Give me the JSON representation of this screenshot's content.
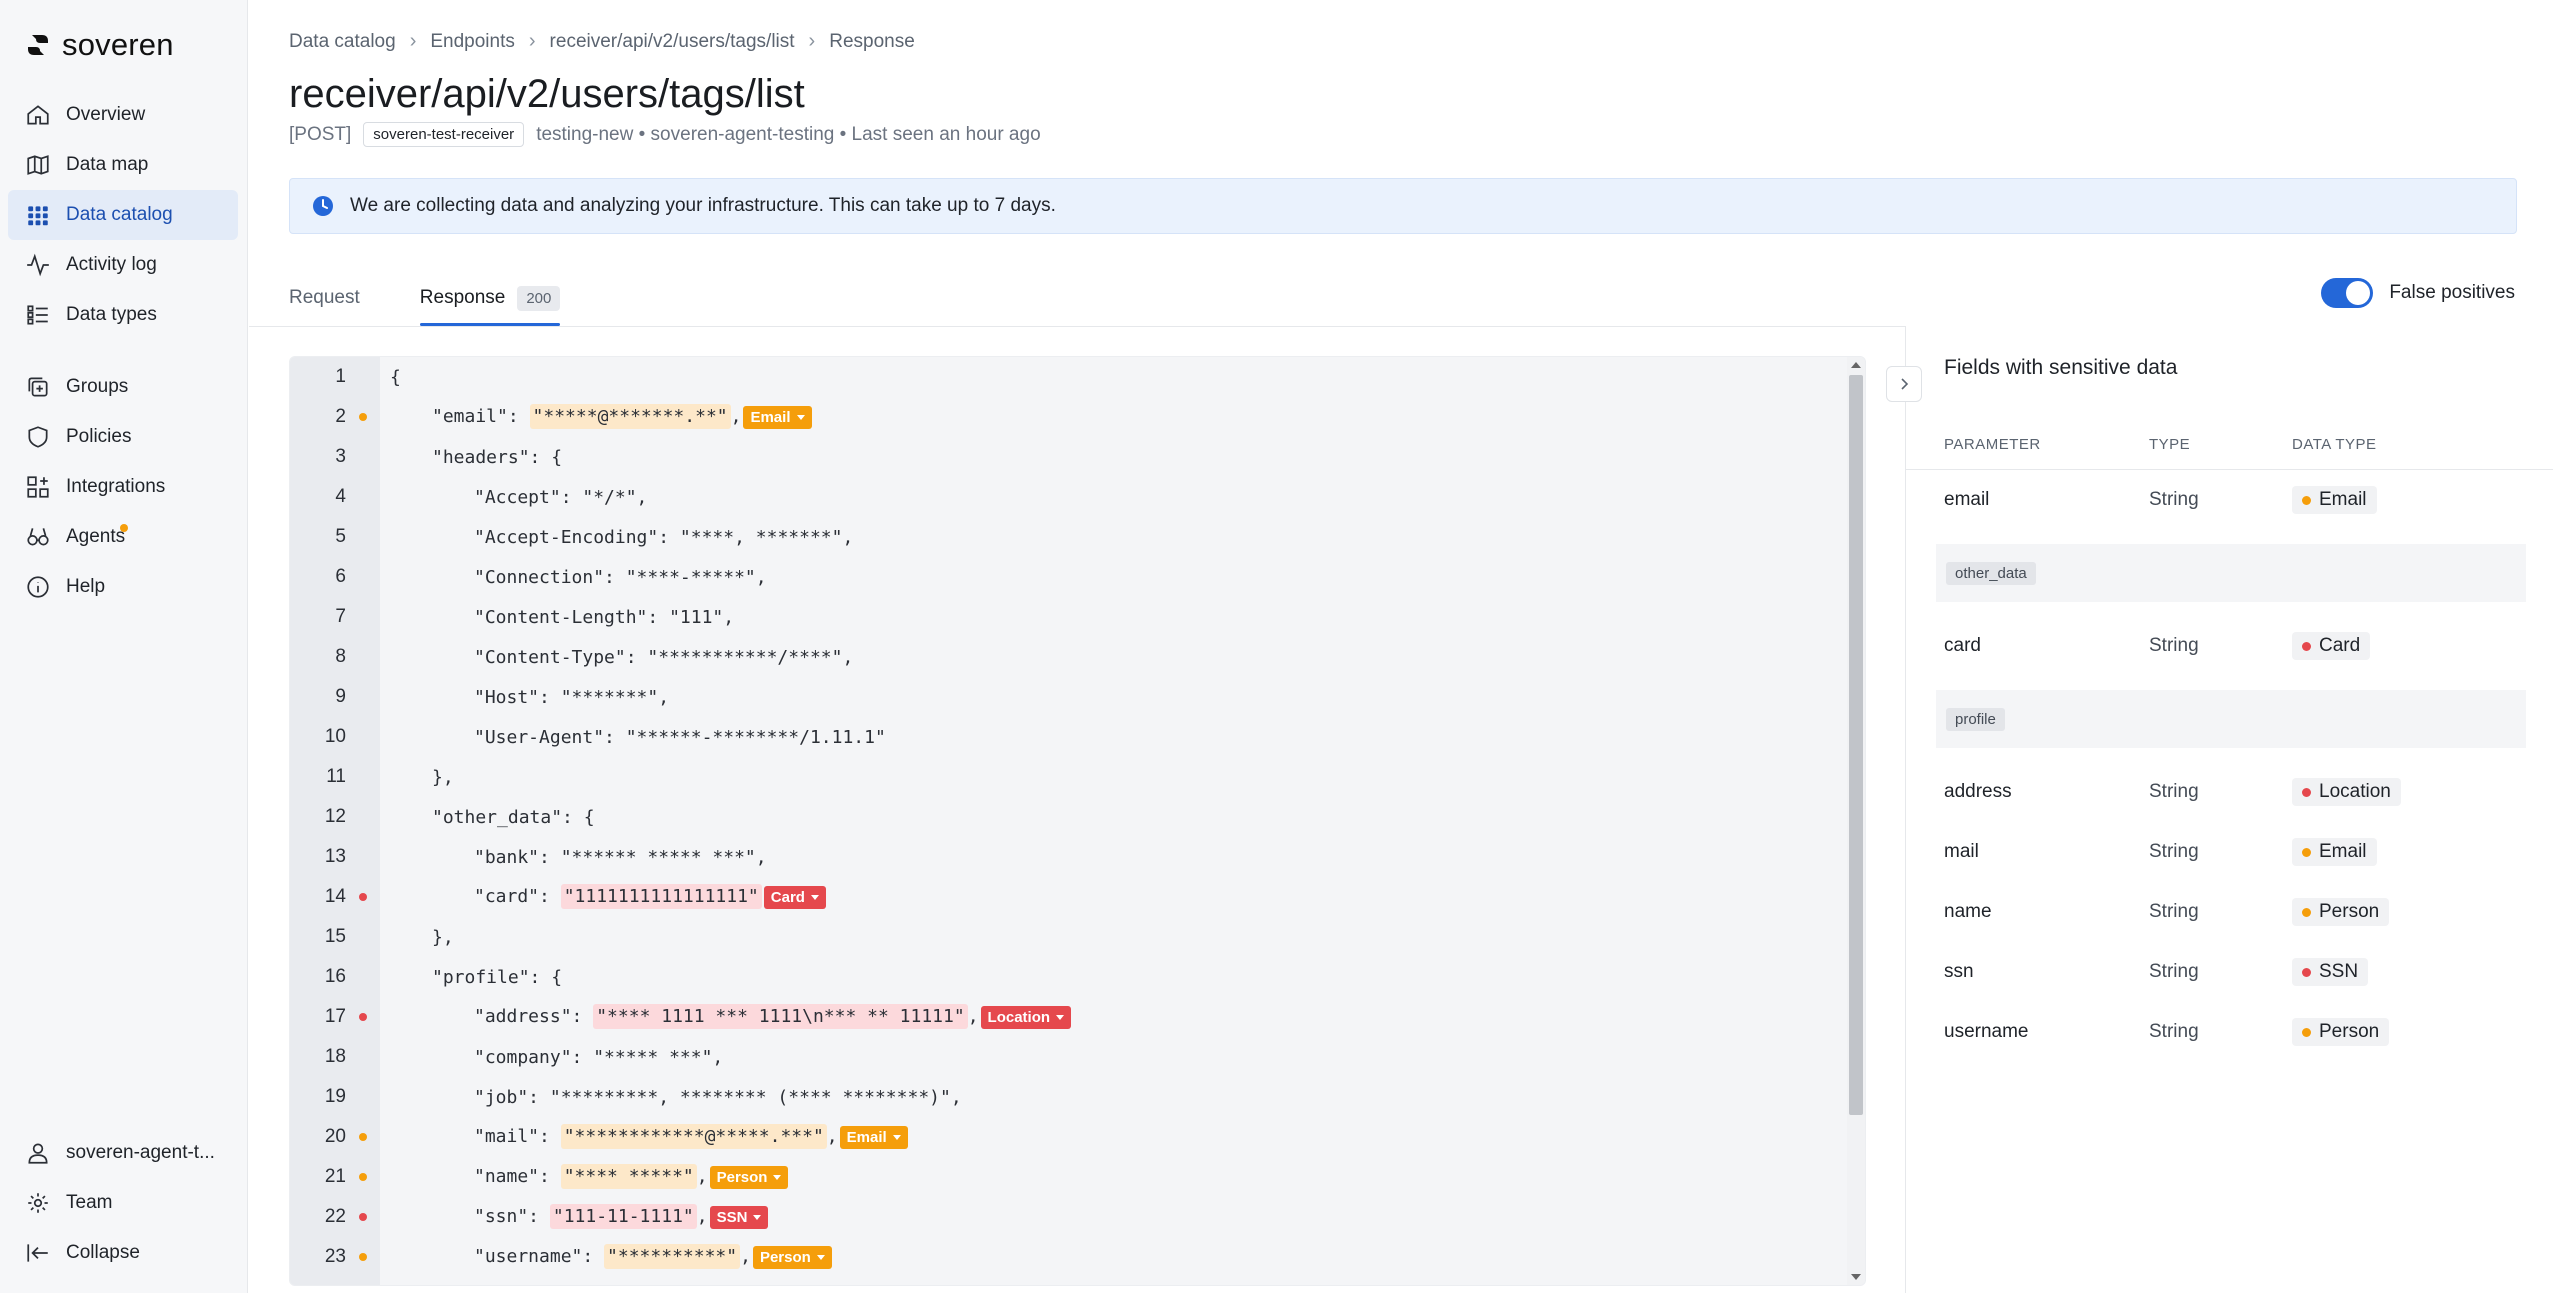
{
  "brand": {
    "name": "soveren"
  },
  "sidebar": {
    "top": [
      {
        "label": "Overview",
        "icon": "home-icon"
      },
      {
        "label": "Data map",
        "icon": "map-icon"
      },
      {
        "label": "Data catalog",
        "icon": "grid-icon",
        "active": true
      },
      {
        "label": "Activity log",
        "icon": "activity-icon"
      },
      {
        "label": "Data types",
        "icon": "list-icon"
      }
    ],
    "mid": [
      {
        "label": "Groups",
        "icon": "groups-icon"
      },
      {
        "label": "Policies",
        "icon": "shield-icon"
      },
      {
        "label": "Integrations",
        "icon": "integrations-icon"
      },
      {
        "label": "Agents",
        "icon": "agents-icon",
        "badge": true
      },
      {
        "label": "Help",
        "icon": "info-icon"
      }
    ],
    "bottom": [
      {
        "label": "soveren-agent-t...",
        "icon": "user-icon"
      },
      {
        "label": "Team",
        "icon": "team-icon"
      },
      {
        "label": "Collapse",
        "icon": "collapse-icon"
      }
    ]
  },
  "breadcrumb": [
    "Data catalog",
    "Endpoints",
    "receiver/api/v2/users/tags/list",
    "Response"
  ],
  "page": {
    "title": "receiver/api/v2/users/tags/list",
    "method": "[POST]",
    "service_tag": "soveren-test-receiver",
    "meta_text": "testing-new • soveren-agent-testing • Last seen an hour ago"
  },
  "banner": {
    "text": "We are collecting data and analyzing your infrastructure. This can take up to 7 days."
  },
  "tabs": [
    {
      "label": "Request"
    },
    {
      "label": "Response",
      "badge": "200",
      "active": true
    }
  ],
  "toggle": {
    "label": "False positives",
    "on": true
  },
  "colors": {
    "accent": "#2467d8",
    "orange": "#f59e0b",
    "red": "#e5484d"
  },
  "code_lines": [
    {
      "n": "1",
      "indent": 0,
      "key": "",
      "value": "{",
      "mark": "",
      "tag": ""
    },
    {
      "n": "2",
      "indent": 1,
      "key": "\"email\": ",
      "value": "\"*****@*******.**\"",
      "comma": ",",
      "mark": "orange",
      "tag": "Email"
    },
    {
      "n": "3",
      "indent": 1,
      "key": "\"headers\": ",
      "value": "{",
      "mark": "",
      "tag": ""
    },
    {
      "n": "4",
      "indent": 2,
      "key": "\"Accept\": ",
      "value": "\"*/*\",",
      "mark": "",
      "tag": ""
    },
    {
      "n": "5",
      "indent": 2,
      "key": "\"Accept-Encoding\": ",
      "value": "\"****, *******\",",
      "mark": "",
      "tag": ""
    },
    {
      "n": "6",
      "indent": 2,
      "key": "\"Connection\": ",
      "value": "\"****-*****\",",
      "mark": "",
      "tag": ""
    },
    {
      "n": "7",
      "indent": 2,
      "key": "\"Content-Length\": ",
      "value": "\"111\",",
      "mark": "",
      "tag": ""
    },
    {
      "n": "8",
      "indent": 2,
      "key": "\"Content-Type\": ",
      "value": "\"***********/****\",",
      "mark": "",
      "tag": ""
    },
    {
      "n": "9",
      "indent": 2,
      "key": "\"Host\": ",
      "value": "\"*******\",",
      "mark": "",
      "tag": ""
    },
    {
      "n": "10",
      "indent": 2,
      "key": "\"User-Agent\": ",
      "value": "\"******-********/1.11.1\"",
      "mark": "",
      "tag": ""
    },
    {
      "n": "11",
      "indent": 1,
      "key": "",
      "value": "},",
      "mark": "",
      "tag": ""
    },
    {
      "n": "12",
      "indent": 1,
      "key": "\"other_data\": ",
      "value": "{",
      "mark": "",
      "tag": ""
    },
    {
      "n": "13",
      "indent": 2,
      "key": "\"bank\": ",
      "value": "\"****** ***** ***\",",
      "mark": "",
      "tag": ""
    },
    {
      "n": "14",
      "indent": 2,
      "key": "\"card\": ",
      "value": "\"1111111111111111\"",
      "comma": "",
      "mark": "red",
      "tag": "Card"
    },
    {
      "n": "15",
      "indent": 1,
      "key": "",
      "value": "},",
      "mark": "",
      "tag": ""
    },
    {
      "n": "16",
      "indent": 1,
      "key": "\"profile\": ",
      "value": "{",
      "mark": "",
      "tag": ""
    },
    {
      "n": "17",
      "indent": 2,
      "key": "\"address\": ",
      "value": "\"**** 1111 *** 1111\\n*** ** 11111\"",
      "comma": ",",
      "mark": "red",
      "tag": "Location"
    },
    {
      "n": "18",
      "indent": 2,
      "key": "\"company\": ",
      "value": "\"***** ***\",",
      "mark": "",
      "tag": ""
    },
    {
      "n": "19",
      "indent": 2,
      "key": "\"job\": ",
      "value": "\"*********, ******** (**** ********)\",",
      "mark": "",
      "tag": ""
    },
    {
      "n": "20",
      "indent": 2,
      "key": "\"mail\": ",
      "value": "\"************@*****.***\"",
      "comma": ",",
      "mark": "orange",
      "tag": "Email"
    },
    {
      "n": "21",
      "indent": 2,
      "key": "\"name\": ",
      "value": "\"**** *****\"",
      "comma": ",",
      "mark": "orange",
      "tag": "Person"
    },
    {
      "n": "22",
      "indent": 2,
      "key": "\"ssn\": ",
      "value": "\"111-11-1111\"",
      "comma": ",",
      "mark": "red",
      "tag": "SSN"
    },
    {
      "n": "23",
      "indent": 2,
      "key": "\"username\": ",
      "value": "\"**********\"",
      "comma": ",",
      "mark": "orange",
      "tag": "Person"
    }
  ],
  "panel": {
    "title": "Fields with sensitive data",
    "headers": {
      "parameter": "PARAMETER",
      "type": "TYPE",
      "data_type": "DATA TYPE"
    },
    "rows": [
      {
        "kind": "field",
        "param": "email",
        "type": "String",
        "data_type": "Email",
        "color": "orange"
      },
      {
        "kind": "group",
        "label": "other_data"
      },
      {
        "kind": "field",
        "param": "card",
        "type": "String",
        "data_type": "Card",
        "color": "red"
      },
      {
        "kind": "group",
        "label": "profile"
      },
      {
        "kind": "field",
        "param": "address",
        "type": "String",
        "data_type": "Location",
        "color": "red"
      },
      {
        "kind": "field",
        "param": "mail",
        "type": "String",
        "data_type": "Email",
        "color": "orange"
      },
      {
        "kind": "field",
        "param": "name",
        "type": "String",
        "data_type": "Person",
        "color": "orange"
      },
      {
        "kind": "field",
        "param": "ssn",
        "type": "String",
        "data_type": "SSN",
        "color": "red"
      },
      {
        "kind": "field",
        "param": "username",
        "type": "String",
        "data_type": "Person",
        "color": "orange"
      }
    ]
  }
}
